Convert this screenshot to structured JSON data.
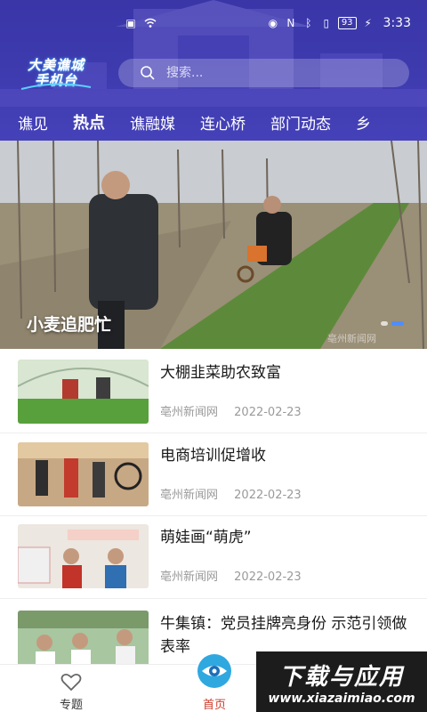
{
  "status_bar": {
    "battery": "93",
    "time": "3:33"
  },
  "header": {
    "logo_line1": "大美谯城",
    "logo_line2": "手机台",
    "search_placeholder": "搜索..."
  },
  "tabs": [
    {
      "label": "谯见",
      "active": false
    },
    {
      "label": "热点",
      "active": true
    },
    {
      "label": "谯融媒",
      "active": false
    },
    {
      "label": "连心桥",
      "active": false
    },
    {
      "label": "部门动态",
      "active": false
    },
    {
      "label": "乡",
      "active": false
    }
  ],
  "banner": {
    "caption": "小麦追肥忙",
    "watermark": "亳州新闻网",
    "slide_index": 2,
    "slide_count": 2
  },
  "news": [
    {
      "title": "大棚韭菜助农致富",
      "source": "亳州新闻网",
      "date": "2022-02-23"
    },
    {
      "title": "电商培训促增收",
      "source": "亳州新闻网",
      "date": "2022-02-23"
    },
    {
      "title": "萌娃画“萌虎”",
      "source": "亳州新闻网",
      "date": "2022-02-23"
    },
    {
      "title": "牛集镇：党员挂牌亮身份 示范引领做表率",
      "source": "",
      "date": ""
    }
  ],
  "bottom_nav": {
    "topics_label": "专题",
    "home_label": "首页"
  },
  "overlay_watermark": {
    "title": "下载与应用",
    "url": "www.xiazaimiao.com"
  },
  "colors": {
    "header_bg": "#3d3aae",
    "accent_red": "#d13a2b",
    "meta_gray": "#9a9a9a"
  }
}
